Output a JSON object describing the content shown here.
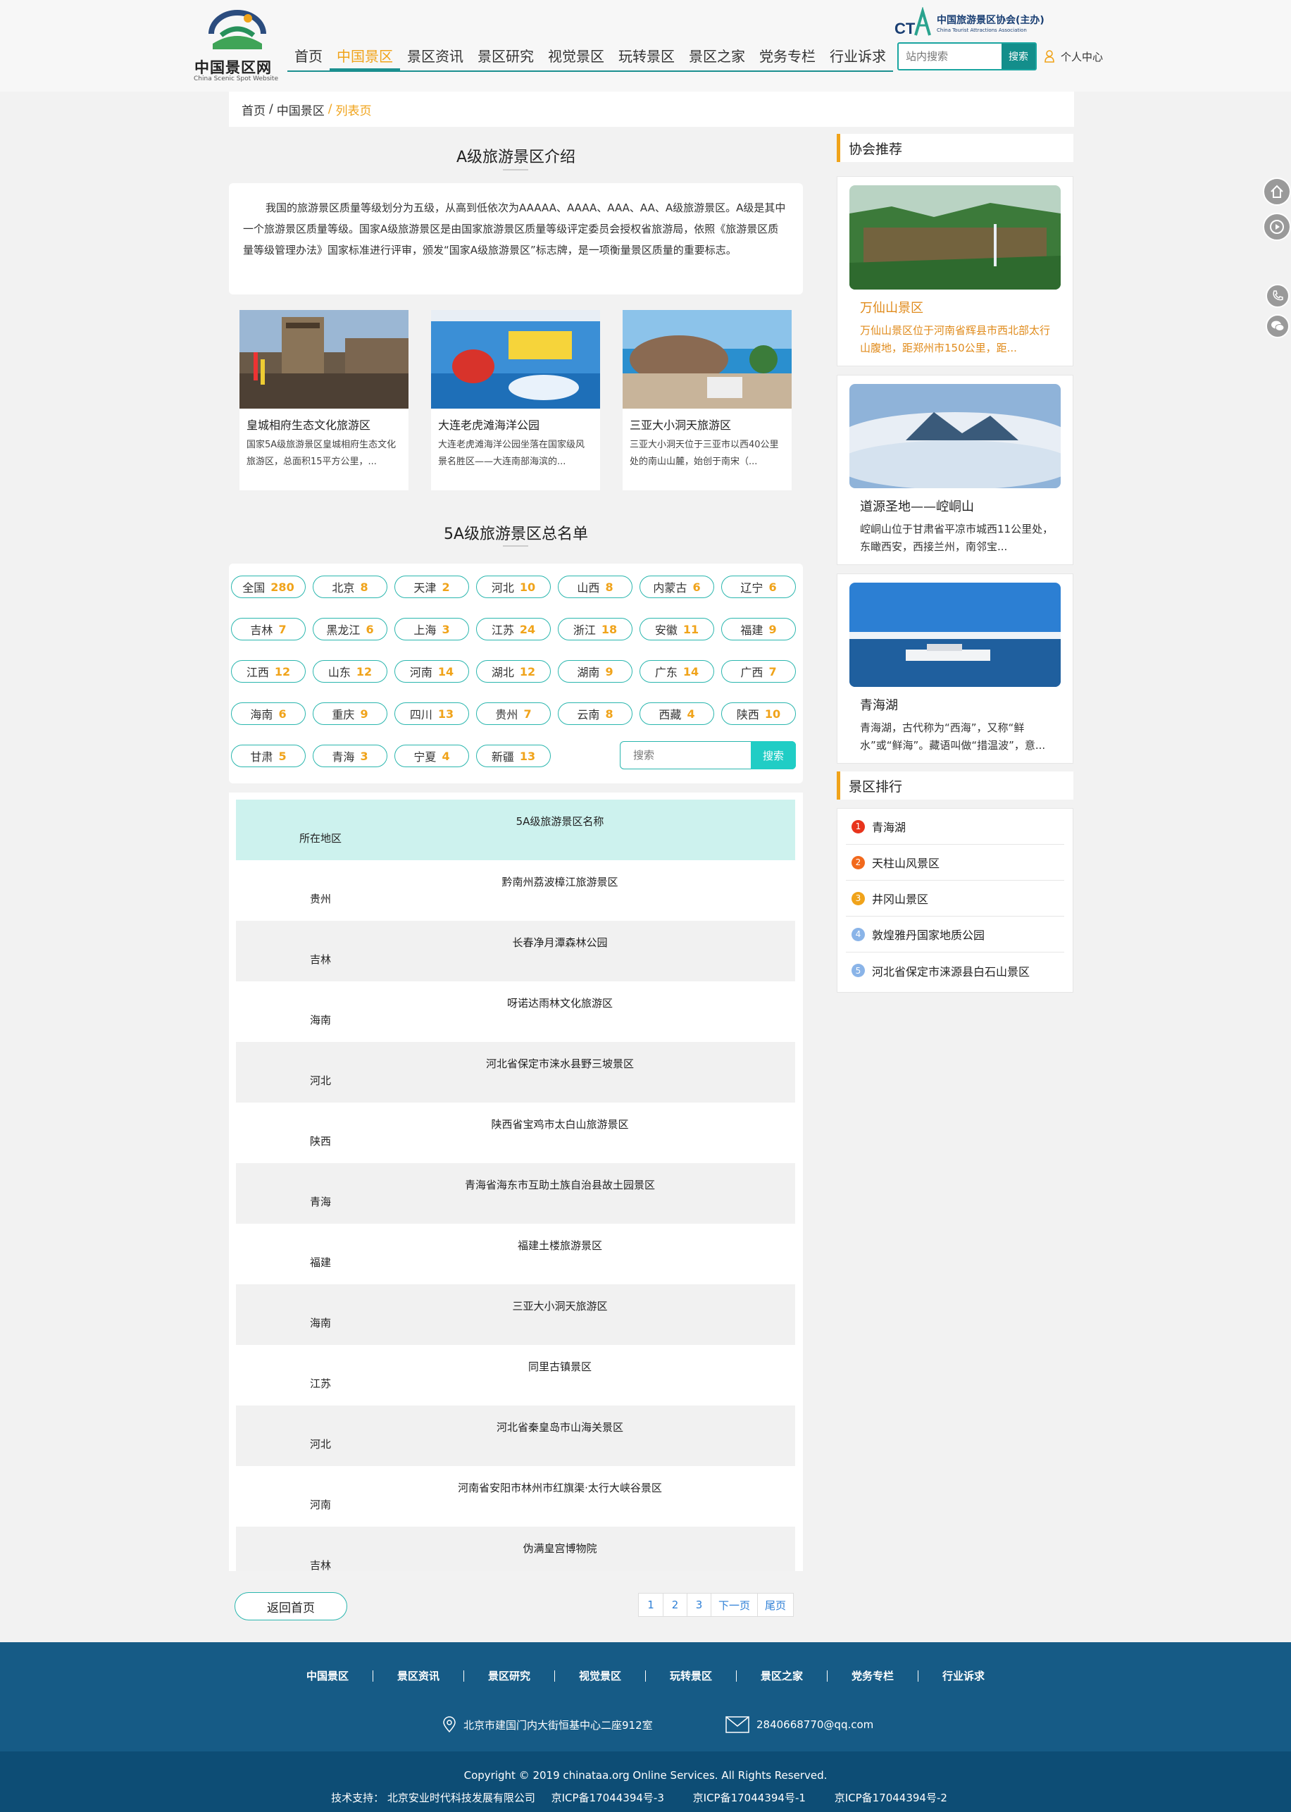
{
  "header": {
    "logo_title": "中国景区网",
    "logo_subtitle": "China Scenic Spot Website",
    "nav": [
      "首页",
      "中国景区",
      "景区资讯",
      "景区研究",
      "视觉景区",
      "玩转景区",
      "景区之家",
      "党务专栏",
      "行业诉求"
    ],
    "active_nav": "中国景区",
    "association_name": "中国旅游景区协会(主办)",
    "association_en": "China Tourist Attractions Association",
    "search_placeholder": "站内搜索",
    "search_button": "搜索",
    "user_center": "个人中心"
  },
  "breadcrumb": {
    "home": "首页",
    "sep": "/",
    "section": "中国景区",
    "current": "列表页"
  },
  "intro": {
    "title": "A级旅游景区介绍",
    "text": "我国的旅游景区质量等级划分为五级，从高到低依次为AAAAA、AAAA、AAA、AA、A级旅游景区。A级是其中一个旅游景区质量等级。国家A级旅游景区是由国家旅游景区质量等级评定委员会授权省旅游局，依照《旅游景区质量等级管理办法》国家标准进行评审，颁发“国家A级旅游景区”标志牌，是一项衡量景区质量的重要标志。"
  },
  "cards": [
    {
      "title": "皇城相府生态文化旅游区",
      "desc": "国家5A级旅游景区皇城相府生态文化旅游区，总面积15平方公里，..."
    },
    {
      "title": "大连老虎滩海洋公园",
      "desc": "大连老虎滩海洋公园坐落在国家级风景名胜区——大连南部海滨的..."
    },
    {
      "title": "三亚大小洞天旅游区",
      "desc": "三亚大小洞天位于三亚市以西40公里处的南山山麓，始创于南宋（..."
    }
  ],
  "list_title": "5A级旅游景区总名单",
  "provinces": [
    {
      "name": "全国",
      "count": "280"
    },
    {
      "name": "北京",
      "count": "8"
    },
    {
      "name": "天津",
      "count": "2"
    },
    {
      "name": "河北",
      "count": "10"
    },
    {
      "name": "山西",
      "count": "8"
    },
    {
      "name": "内蒙古",
      "count": "6"
    },
    {
      "name": "辽宁",
      "count": "6"
    },
    {
      "name": "吉林",
      "count": "7"
    },
    {
      "name": "黑龙江",
      "count": "6"
    },
    {
      "name": "上海",
      "count": "3"
    },
    {
      "name": "江苏",
      "count": "24"
    },
    {
      "name": "浙江",
      "count": "18"
    },
    {
      "name": "安徽",
      "count": "11"
    },
    {
      "name": "福建",
      "count": "9"
    },
    {
      "name": "江西",
      "count": "12"
    },
    {
      "name": "山东",
      "count": "12"
    },
    {
      "name": "河南",
      "count": "14"
    },
    {
      "name": "湖北",
      "count": "12"
    },
    {
      "name": "湖南",
      "count": "9"
    },
    {
      "name": "广东",
      "count": "14"
    },
    {
      "name": "广西",
      "count": "7"
    },
    {
      "name": "海南",
      "count": "6"
    },
    {
      "name": "重庆",
      "count": "9"
    },
    {
      "name": "四川",
      "count": "13"
    },
    {
      "name": "贵州",
      "count": "7"
    },
    {
      "name": "云南",
      "count": "8"
    },
    {
      "name": "西藏",
      "count": "4"
    },
    {
      "name": "陕西",
      "count": "10"
    },
    {
      "name": "甘肃",
      "count": "5"
    },
    {
      "name": "青海",
      "count": "3"
    },
    {
      "name": "宁夏",
      "count": "4"
    },
    {
      "name": "新疆",
      "count": "13"
    }
  ],
  "province_search": {
    "placeholder": "搜索",
    "button": "搜索"
  },
  "table": {
    "header_name": "5A级旅游景区名称",
    "header_region": "所在地区",
    "rows": [
      {
        "name": "黔南州荔波樟江旅游景区",
        "region": "贵州"
      },
      {
        "name": "长春净月潭森林公园",
        "region": "吉林"
      },
      {
        "name": "呀诺达雨林文化旅游区",
        "region": "海南"
      },
      {
        "name": "河北省保定市涞水县野三坡景区",
        "region": "河北"
      },
      {
        "name": "陕西省宝鸡市太白山旅游景区",
        "region": "陕西"
      },
      {
        "name": "青海省海东市互助土族自治县故土园景区",
        "region": "青海"
      },
      {
        "name": "福建土楼旅游景区",
        "region": "福建"
      },
      {
        "name": "三亚大小洞天旅游区",
        "region": "海南"
      },
      {
        "name": "同里古镇景区",
        "region": "江苏"
      },
      {
        "name": "河北省秦皇岛市山海关景区",
        "region": "河北"
      },
      {
        "name": "河南省安阳市林州市红旗渠·太行大峡谷景区",
        "region": "河南"
      },
      {
        "name": "伪满皇宫博物院",
        "region": "吉林"
      }
    ]
  },
  "back_home": "返回首页",
  "pagination": [
    "1",
    "2",
    "3",
    "下一页",
    "尾页"
  ],
  "sidebar": {
    "recommend_title": "协会推荐",
    "recommend": [
      {
        "title": "万仙山景区",
        "desc": "万仙山景区位于河南省辉县市西北部太行山腹地，距郑州市150公里，距..."
      },
      {
        "title": "道源圣地——崆峒山",
        "desc": "崆峒山位于甘肃省平凉市城西11公里处，东瞰西安，西接兰州，南邻宝..."
      },
      {
        "title": "青海湖",
        "desc": "青海湖，古代称为“西海”，又称“鲜水”或“鲜海”。藏语叫做“措温波”，意..."
      }
    ],
    "ranking_title": "景区排行",
    "ranking": [
      {
        "num": "1",
        "name": "青海湖",
        "color": "#e8341c"
      },
      {
        "num": "2",
        "name": "天柱山风景区",
        "color": "#f2691c"
      },
      {
        "num": "3",
        "name": "井冈山景区",
        "color": "#f0a31a"
      },
      {
        "num": "4",
        "name": "敦煌雅丹国家地质公园",
        "color": "#8ab4e8"
      },
      {
        "num": "5",
        "name": "河北省保定市涞源县白石山景区",
        "color": "#8ab4e8"
      }
    ]
  },
  "footer": {
    "nav": [
      "中国景区",
      "景区资讯",
      "景区研究",
      "视觉景区",
      "玩转景区",
      "景区之家",
      "党务专栏",
      "行业诉求"
    ],
    "address": "北京市建国门内大街恒基中心二座912室",
    "email": "2840668770@qq.com",
    "copyright": "Copyright © 2019 chinataa.org Online Services. All Rights Reserved.",
    "tech_support": "技术支持： 北京安业时代科技发展有限公司",
    "icp": [
      "京ICP备17044394号-3",
      "京ICP备17044394号-1",
      "京ICP备17044394号-2"
    ]
  }
}
